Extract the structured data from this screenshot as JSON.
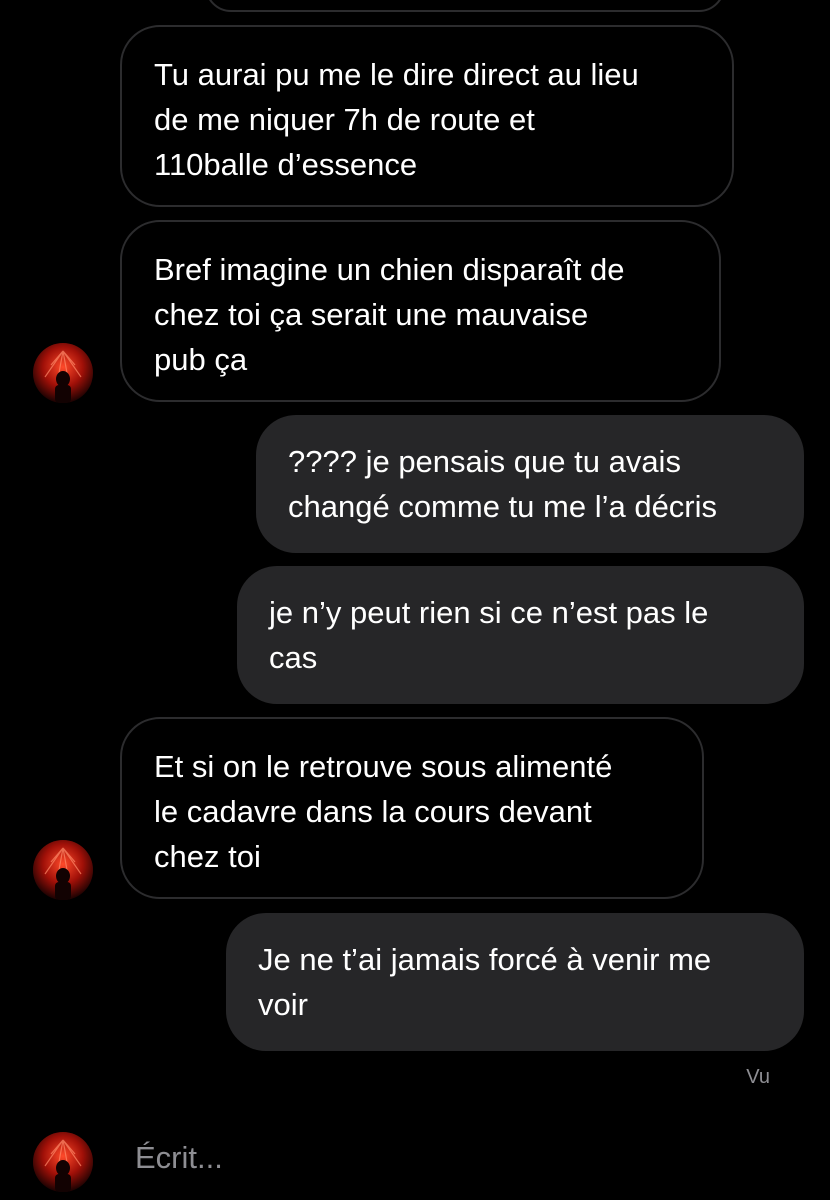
{
  "conversation": {
    "messages": [
      {
        "id": "m0",
        "sender": "contact",
        "text": ""
      },
      {
        "id": "m1",
        "sender": "contact",
        "text": "Tu aurai pu me le dire direct au lieu\nde me niquer 7h de route et\n110balle d’essence"
      },
      {
        "id": "m2",
        "sender": "contact",
        "text": "Bref imagine un chien disparaît de\nchez toi ça serait une mauvaise\npub ça"
      },
      {
        "id": "m3",
        "sender": "me",
        "text": "???? je pensais que tu avais\nchangé comme tu me l’a décris"
      },
      {
        "id": "m4",
        "sender": "me",
        "text": "je n’y peut rien si ce n’est pas le\ncas"
      },
      {
        "id": "m5",
        "sender": "contact",
        "text": "Et si on le retrouve sous alimenté\nle cadavre dans la cours devant\nchez toi"
      },
      {
        "id": "m6",
        "sender": "me",
        "text": "Je ne t’ai jamais forcé à venir me\nvoir"
      }
    ],
    "seen_label": "Vu",
    "typing_label": "Écrit..."
  },
  "colors": {
    "background": "#000000",
    "received_border": "#2c2c2e",
    "sent_bubble": "#262628",
    "secondary_text": "#8e8e93",
    "avatar_accent": "#c21a12"
  },
  "icons": {
    "avatar": "contact-profile-picture"
  }
}
